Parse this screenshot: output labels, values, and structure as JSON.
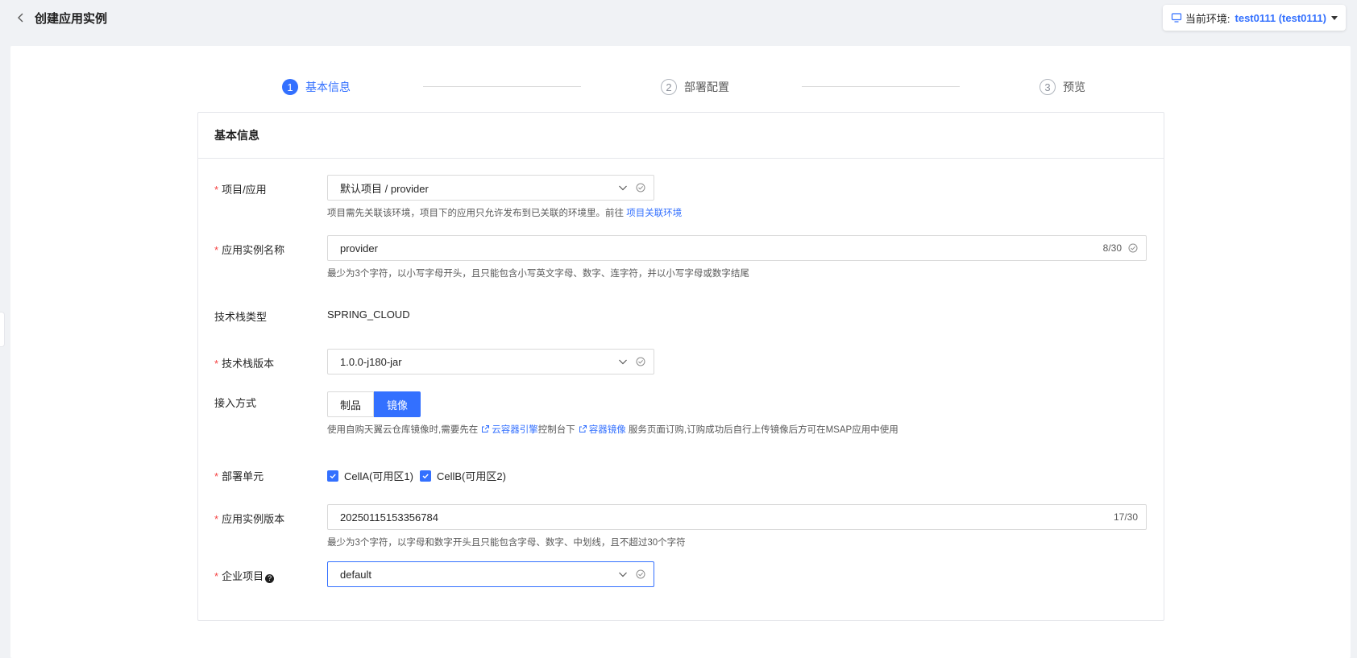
{
  "header": {
    "title": "创建应用实例",
    "env_label": "当前环境:",
    "env_value": "test0111 (test0111)"
  },
  "steps": [
    {
      "num": "1",
      "label": "基本信息",
      "state": "active"
    },
    {
      "num": "2",
      "label": "部署配置",
      "state": "inactive"
    },
    {
      "num": "3",
      "label": "预览",
      "state": "inactive"
    }
  ],
  "form": {
    "section_title": "基本信息",
    "project": {
      "label": "项目/应用",
      "value": "默认项目 / provider",
      "hint": "项目需先关联该环境，项目下的应用只允许发布到已关联的环境里。前往",
      "hint_link": "项目关联环境"
    },
    "instance_name": {
      "label": "应用实例名称",
      "value": "provider",
      "count": "8/30",
      "hint": "最少为3个字符，以小写字母开头，且只能包含小写英文字母、数字、连字符，并以小写字母或数字结尾"
    },
    "stack_type": {
      "label": "技术栈类型",
      "value": "SPRING_CLOUD"
    },
    "stack_version": {
      "label": "技术栈版本",
      "value": "1.0.0-j180-jar"
    },
    "access_mode": {
      "label": "接入方式",
      "options": [
        "制品",
        "镜像"
      ],
      "selected": "镜像",
      "hint_prefix": "使用自购天翼云仓库镜像时,需要先在",
      "hint_link1": "云容器引擎",
      "hint_mid": "控制台下",
      "hint_link2": "容器镜像",
      "hint_suffix": "服务页面订购,订购成功后自行上传镜像后方可在MSAP应用中使用"
    },
    "deploy_unit": {
      "label": "部署单元",
      "options": [
        {
          "label": "CellA(可用区1)",
          "checked": true
        },
        {
          "label": "CellB(可用区2)",
          "checked": true
        }
      ]
    },
    "instance_version": {
      "label": "应用实例版本",
      "value": "20250115153356784",
      "count": "17/30",
      "hint": "最少为3个字符，以字母和数字开头且只能包含字母、数字、中划线，且不超过30个字符"
    },
    "enterprise_project": {
      "label": "企业项目",
      "value": "default"
    }
  },
  "colors": {
    "accent": "#3370ff",
    "required": "#f53f3f",
    "background": "#f0f2f5"
  }
}
